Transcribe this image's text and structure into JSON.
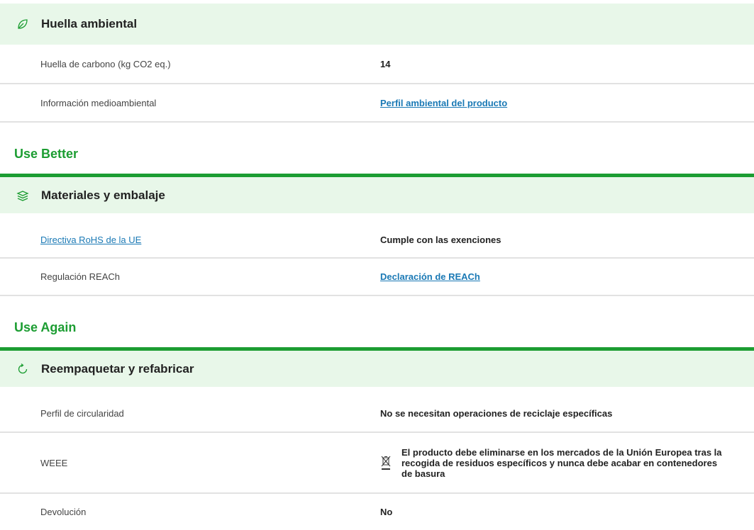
{
  "sections": {
    "footprint": {
      "title": "Huella ambiental",
      "icon": "leaf-icon",
      "rows": [
        {
          "label": "Huella de carbono (kg CO2 eq.)",
          "value": "14"
        },
        {
          "label": "Información medioambiental",
          "value": "Perfil ambiental del producto"
        }
      ]
    },
    "use_better": {
      "group_title": "Use Better",
      "title": "Materiales y embalaje",
      "icon": "layers-icon",
      "rows": [
        {
          "label": "Directiva RoHS de la UE",
          "value": "Cumple con las exenciones"
        },
        {
          "label": "Regulación REACh",
          "value": "Declaración de REACh"
        }
      ]
    },
    "use_again": {
      "group_title": "Use Again",
      "title": "Reempaquetar y refabricar",
      "icon": "refresh-icon",
      "rows": [
        {
          "label": "Perfil de circularidad",
          "value": "No se necesitan operaciones de reciclaje específicas"
        },
        {
          "label": "WEEE",
          "value": "El producto debe eliminarse en los mercados de la Unión Europea tras la recogida de residuos específicos y nunca debe acabar en contenedores de basura",
          "icon": "crossed-bin-icon"
        },
        {
          "label": "Devolución",
          "value": "No"
        }
      ]
    }
  },
  "colors": {
    "accent": "#1c9d32",
    "header_bg": "#e8f7e9",
    "link": "#1a79b5"
  }
}
